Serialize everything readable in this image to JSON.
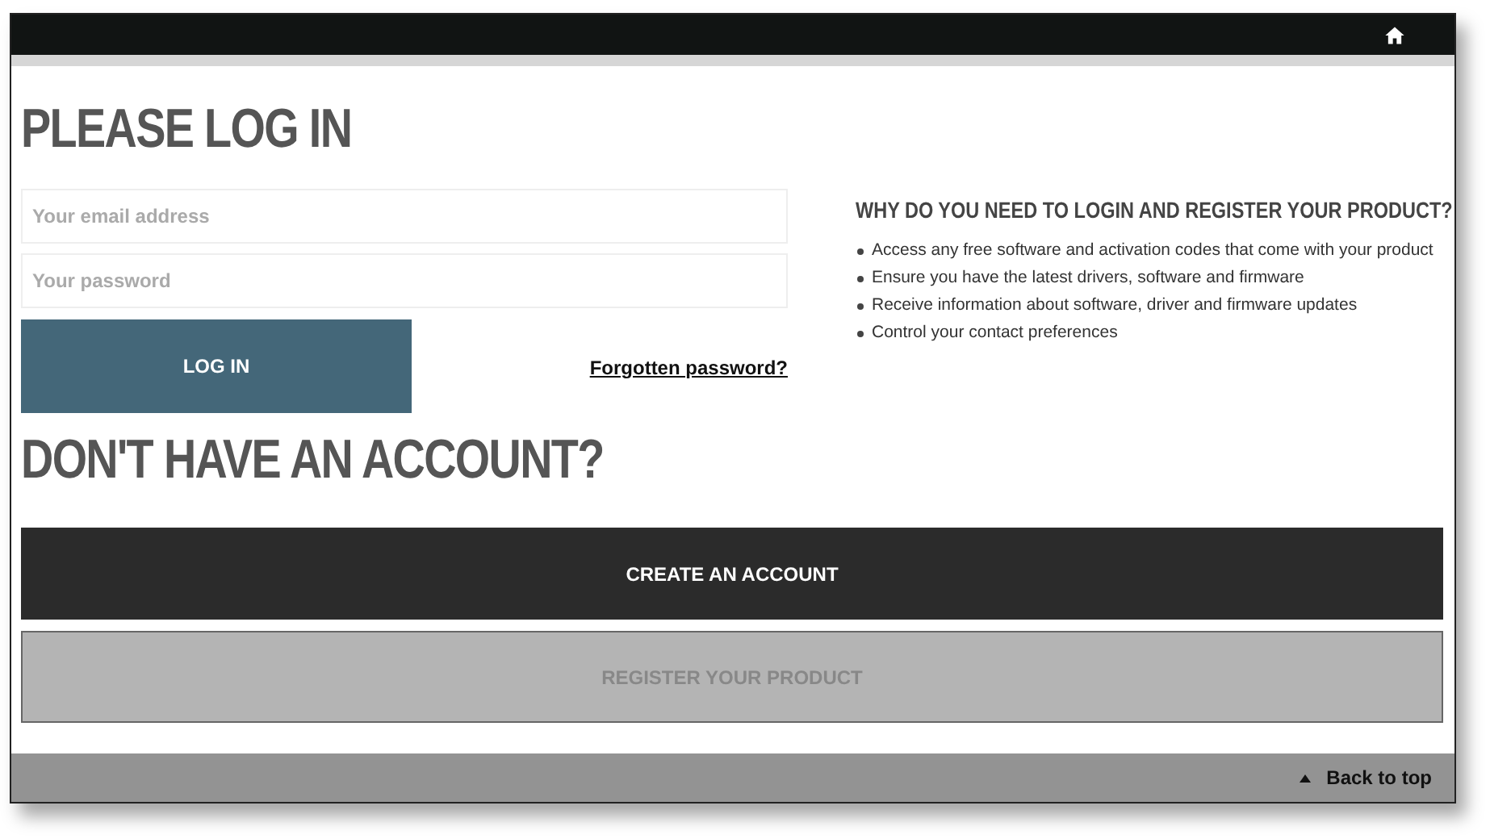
{
  "login": {
    "title": "PLEASE LOG IN",
    "fields": [
      {
        "placeholder": "Your email address"
      },
      {
        "placeholder": "Your password"
      }
    ],
    "button": "LOG IN",
    "forgot_link": "Forgotten password?"
  },
  "info": {
    "title": "WHY DO YOU NEED TO LOGIN AND REGISTER YOUR PRODUCT?",
    "items": [
      "Access any free software and activation codes that come with your product",
      "Ensure you have the latest drivers, software and firmware",
      "Receive information about software, driver and firmware updates",
      "Control your contact preferences"
    ]
  },
  "account": {
    "title": "DON'T HAVE AN ACCOUNT?",
    "buttons": [
      {
        "label": "CREATE AN ACCOUNT",
        "disabled": false
      },
      {
        "label": "REGISTER YOUR PRODUCT",
        "disabled": true
      }
    ]
  },
  "footer": {
    "back_to_top": "Back to top"
  }
}
